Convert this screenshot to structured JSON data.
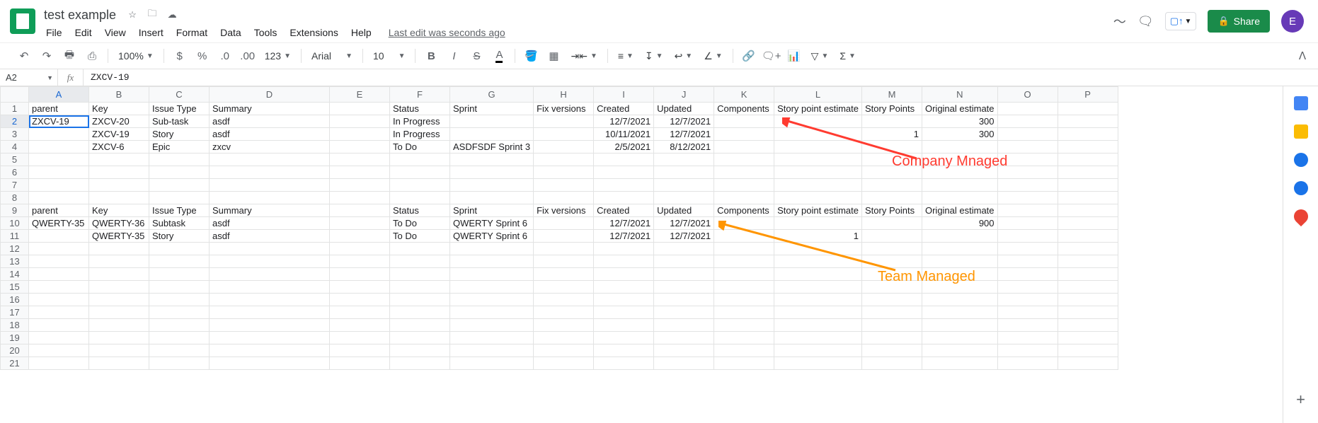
{
  "header": {
    "doc_title": "test example",
    "menus": [
      "File",
      "Edit",
      "View",
      "Insert",
      "Format",
      "Data",
      "Tools",
      "Extensions",
      "Help"
    ],
    "last_edit": "Last edit was seconds ago",
    "share_label": "Share",
    "avatar_letter": "E"
  },
  "toolbar": {
    "zoom": "100%",
    "format_items": [
      "$",
      "%",
      ".0",
      ".00",
      "123"
    ],
    "font": "Arial",
    "font_size": "10"
  },
  "formula_bar": {
    "cell_ref": "A2",
    "fx_label": "fx",
    "value": "ZXCV-19"
  },
  "columns": [
    "A",
    "B",
    "C",
    "D",
    "E",
    "F",
    "G",
    "H",
    "I",
    "J",
    "K",
    "L",
    "M",
    "N",
    "O",
    "P"
  ],
  "selected_cell": {
    "row": 2,
    "col": "A"
  },
  "rows": [
    {
      "n": 1,
      "cells": {
        "A": "parent",
        "B": "Key",
        "C": "Issue Type",
        "D": "Summary",
        "F": "Status",
        "G": "Sprint",
        "H": "Fix versions",
        "I": "Created",
        "J": "Updated",
        "K": "Components",
        "L": "Story point estimate",
        "M": "Story Points",
        "N": "Original estimate"
      }
    },
    {
      "n": 2,
      "cells": {
        "A": "ZXCV-19",
        "B": "ZXCV-20",
        "C": "Sub-task",
        "D": "asdf",
        "F": "In Progress",
        "I": "12/7/2021",
        "J": "12/7/2021",
        "N": "300"
      },
      "numcols": [
        "I",
        "J",
        "N"
      ]
    },
    {
      "n": 3,
      "cells": {
        "B": "ZXCV-19",
        "C": "Story",
        "D": "asdf",
        "F": "In Progress",
        "I": "10/11/2021",
        "J": "12/7/2021",
        "M": "1",
        "N": "300"
      },
      "numcols": [
        "I",
        "J",
        "M",
        "N"
      ]
    },
    {
      "n": 4,
      "cells": {
        "B": "ZXCV-6",
        "C": "Epic",
        "D": "zxcv",
        "F": "To Do",
        "G": "ASDFSDF Sprint 3",
        "I": "2/5/2021",
        "J": "8/12/2021"
      },
      "numcols": [
        "I",
        "J"
      ]
    },
    {
      "n": 5,
      "cells": {}
    },
    {
      "n": 6,
      "cells": {}
    },
    {
      "n": 7,
      "cells": {}
    },
    {
      "n": 8,
      "cells": {}
    },
    {
      "n": 9,
      "cells": {
        "A": "parent",
        "B": "Key",
        "C": "Issue Type",
        "D": "Summary",
        "F": "Status",
        "G": "Sprint",
        "H": "Fix versions",
        "I": "Created",
        "J": "Updated",
        "K": "Components",
        "L": "Story point estimate",
        "M": "Story Points",
        "N": "Original estimate"
      }
    },
    {
      "n": 10,
      "cells": {
        "A": "QWERTY-35",
        "B": "QWERTY-36",
        "C": "Subtask",
        "D": "asdf",
        "F": "To Do",
        "G": "QWERTY Sprint 6",
        "I": "12/7/2021",
        "J": "12/7/2021",
        "N": "900"
      },
      "numcols": [
        "I",
        "J",
        "N"
      ]
    },
    {
      "n": 11,
      "cells": {
        "B": "QWERTY-35",
        "C": "Story",
        "D": "asdf",
        "F": "To Do",
        "G": "QWERTY Sprint 6",
        "I": "12/7/2021",
        "J": "12/7/2021",
        "L": "1"
      },
      "numcols": [
        "I",
        "J",
        "L"
      ]
    },
    {
      "n": 12,
      "cells": {}
    },
    {
      "n": 13,
      "cells": {}
    },
    {
      "n": 14,
      "cells": {}
    },
    {
      "n": 15,
      "cells": {}
    },
    {
      "n": 16,
      "cells": {}
    },
    {
      "n": 17,
      "cells": {}
    },
    {
      "n": 18,
      "cells": {}
    },
    {
      "n": 19,
      "cells": {}
    },
    {
      "n": 20,
      "cells": {}
    },
    {
      "n": 21,
      "cells": {}
    }
  ],
  "annotations": {
    "company": "Company Mnaged",
    "team": "Team Managed"
  }
}
